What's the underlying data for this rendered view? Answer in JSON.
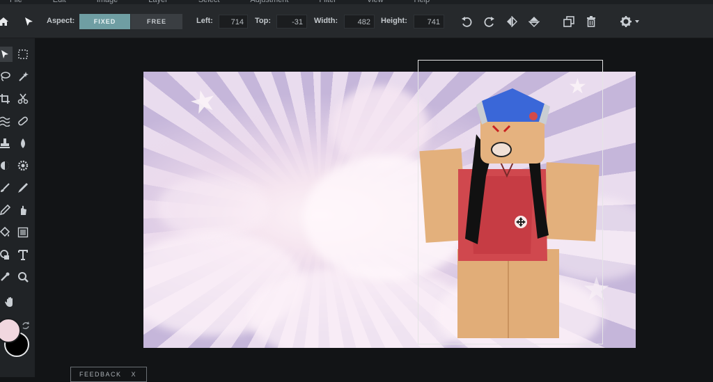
{
  "menu": [
    "File",
    "Edit",
    "Image",
    "Layer",
    "Select",
    "Adjustment",
    "Filter",
    "View",
    "Help"
  ],
  "toolbar": {
    "aspect_label": "Aspect:",
    "aspect_options": [
      "FIXED",
      "FREE"
    ],
    "aspect_selected": "FIXED",
    "left_label": "Left:",
    "left_value": "714",
    "top_label": "Top:",
    "top_value": "-31",
    "width_label": "Width:",
    "width_value": "482",
    "height_label": "Height:",
    "height_value": "741"
  },
  "icons": {
    "home": "home-icon",
    "move": "arrow-pointer-icon",
    "undo": "undo-icon",
    "redo": "redo-icon",
    "flip_h": "flip-horizontal-icon",
    "flip_v": "flip-vertical-icon",
    "duplicate": "duplicate-icon",
    "delete": "trash-icon",
    "settings": "gear-icon"
  },
  "tools": [
    "move",
    "marquee",
    "lasso",
    "magic-wand",
    "crop",
    "scissors",
    "liquify",
    "bandage",
    "stamp",
    "blur-drop",
    "burn",
    "sponge",
    "brush",
    "pen",
    "pencil",
    "smudge",
    "fill",
    "gradient",
    "shape",
    "text",
    "eyedropper",
    "zoom",
    "hand"
  ],
  "colors": {
    "primary": "#f1d7df",
    "secondary": "#000000",
    "accent": "#6f9ea3"
  },
  "feedback": {
    "label": "FEEDBACK",
    "close": "X"
  }
}
